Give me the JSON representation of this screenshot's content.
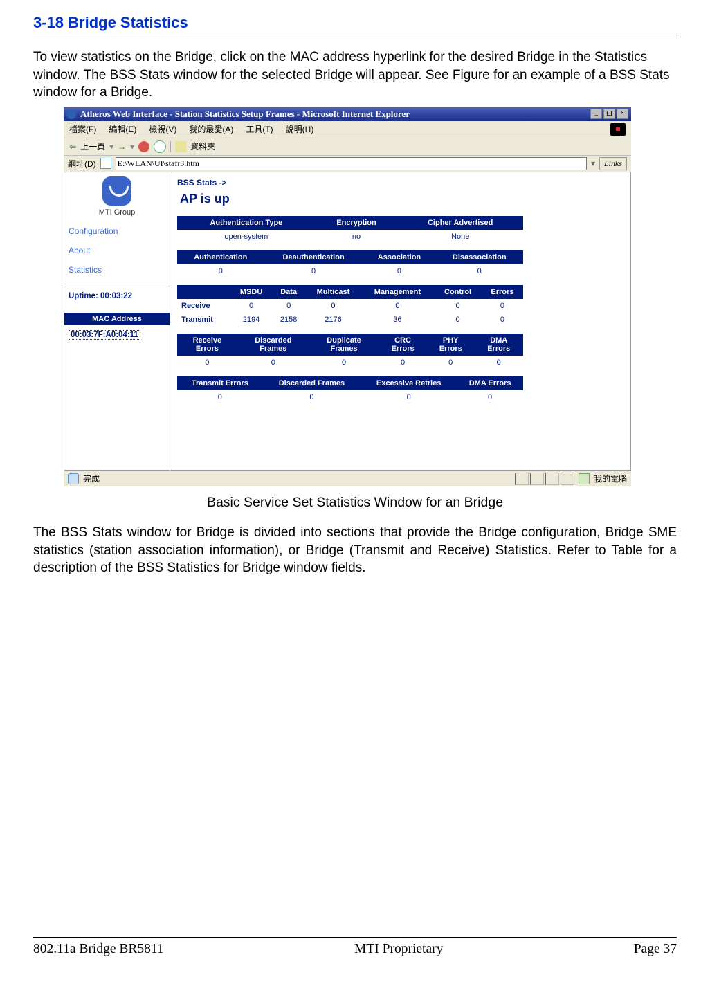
{
  "section_title": "3-18 Bridge Statistics",
  "intro_paragraph": "To view statistics on the Bridge, click on the MAC address hyperlink for the desired Bridge in the Statistics window. The BSS Stats window for the selected Bridge will appear. See Figure for an example of a BSS Stats window for a Bridge.",
  "figure_caption": "Basic Service Set Statistics Window for an Bridge",
  "body_paragraph": "The BSS Stats window for Bridge is divided into sections that provide the Bridge configuration, Bridge SME statistics (station association information), or Bridge (Transmit and Receive) Statistics. Refer to Table for a description of the BSS Statistics for Bridge window fields.",
  "footer": {
    "left": "802.11a Bridge BR5811",
    "center": "MTI Proprietary",
    "right": "Page 37"
  },
  "browser": {
    "title": "Atheros Web Interface - Station Statistics Setup Frames - Microsoft Internet Explorer",
    "menus": {
      "file": "檔案(F)",
      "edit": "編輯(E)",
      "view": "檢視(V)",
      "favorites": "我的最愛(A)",
      "tools": "工具(T)",
      "help": "說明(H)"
    },
    "toolbar": {
      "back": "上一頁",
      "folder": "資料夾"
    },
    "address_label": "網址(D)",
    "address_value": "E:\\WLAN\\UI\\stafr3.htm",
    "links_label": "Links",
    "status_done": "完成",
    "status_right": "我的電腦"
  },
  "sidebar": {
    "logo_text": "MTI Group",
    "links": {
      "configuration": "Configuration",
      "about": "About",
      "statistics": "Statistics"
    },
    "uptime_label": "Uptime: 00:03:22",
    "mac_header": "MAC Address",
    "mac_link": "00:03:7F:A0:04:11"
  },
  "main": {
    "bss_stats_label": "BSS Stats",
    "arrow": "->",
    "ap_status": "AP is  up",
    "table1": {
      "headers": {
        "auth_type": "Authentication Type",
        "encryption": "Encryption",
        "cipher": "Cipher Advertised"
      },
      "row": {
        "auth_type": "open-system",
        "encryption": "no",
        "cipher": "None"
      }
    },
    "table2": {
      "headers": {
        "auth": "Authentication",
        "deauth": "Deauthentication",
        "assoc": "Association",
        "disassoc": "Disassociation"
      },
      "row": {
        "auth": "0",
        "deauth": "0",
        "assoc": "0",
        "disassoc": "0"
      }
    },
    "table3": {
      "headers": {
        "blank": "",
        "msdu": "MSDU",
        "data": "Data",
        "multicast": "Multicast",
        "management": "Management",
        "control": "Control",
        "errors": "Errors"
      },
      "rows": {
        "receive": {
          "label": "Receive",
          "msdu": "0",
          "data": "0",
          "multicast": "0",
          "management": "0",
          "control": "0",
          "errors": "0"
        },
        "transmit": {
          "label": "Transmit",
          "msdu": "2194",
          "data": "2158",
          "multicast": "2176",
          "management": "36",
          "control": "0",
          "errors": "0"
        }
      }
    },
    "table4": {
      "headers": {
        "recv_err": "Receive Errors",
        "disc": "Discarded Frames",
        "dup": "Duplicate Frames",
        "crc": "CRC Errors",
        "phy": "PHY Errors",
        "dma": "DMA Errors"
      },
      "row": {
        "recv_err": "0",
        "disc": "0",
        "dup": "0",
        "crc": "0",
        "phy": "0",
        "dma": "0"
      }
    },
    "table5": {
      "headers": {
        "tx_err": "Transmit Errors",
        "disc": "Discarded Frames",
        "exc": "Excessive Retries",
        "dma": "DMA Errors"
      },
      "row": {
        "tx_err": "0",
        "disc": "0",
        "exc": "0",
        "dma": "0"
      }
    }
  }
}
